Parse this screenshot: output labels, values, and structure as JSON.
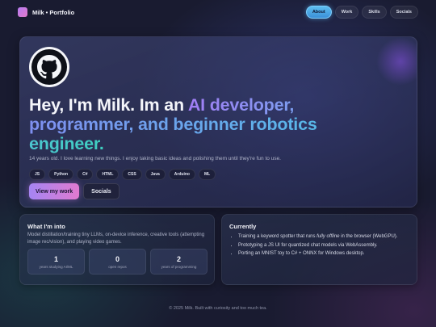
{
  "nav": {
    "brand": "Milk • Portfolio",
    "links": [
      {
        "label": "About",
        "active": true
      },
      {
        "label": "Work",
        "active": false
      },
      {
        "label": "Skills",
        "active": false
      },
      {
        "label": "Socials",
        "active": false
      }
    ]
  },
  "hero": {
    "avatar_icon": "github-octocat-icon",
    "headline": {
      "plain": "Hey, I'm Milk. Im an ",
      "highlight_1": "AI developer,",
      "highlight_2": "programmer, and beginner robotics",
      "highlight_3": "engineer."
    },
    "bio": "14 years old. I love learning new things. I enjoy taking basic ideas and polishing them until they're fun to use.",
    "tags": [
      "JS",
      "Python",
      "C#",
      "HTML",
      "CSS",
      "Java",
      "Arduino",
      "ML"
    ],
    "primary_button": "View my work",
    "secondary_button": "Socials"
  },
  "interests": {
    "title": "What I'm into",
    "description": "Model distillation/training tiny LLMs, on-device inference, creative tools (attempting image rec/vision), and playing video games.",
    "stats": [
      {
        "value": "1",
        "label": "years studying AI/ML"
      },
      {
        "value": "0",
        "label": "open repos"
      },
      {
        "value": "2",
        "label": "years of programming"
      }
    ]
  },
  "currently": {
    "title": "Currently",
    "items": [
      {
        "before": "Training a keyword spotter that runs ",
        "emphasis": "fully offline",
        "after": " in the browser (WebGPU)."
      },
      {
        "before": "Prototyping a JS UI for quantized chat models via WebAssembly.",
        "emphasis": "",
        "after": ""
      },
      {
        "before": "Porting an MNIST toy to C# + ONNX for Windows desktop.",
        "emphasis": "",
        "after": ""
      }
    ]
  },
  "footer": "© 2025 Milk. Built with curiosity and too much tea.",
  "colors": {
    "accent_blue": "#4aa8ee",
    "accent_purple": "#a585f3",
    "accent_pink": "#e07ad0",
    "accent_teal": "#3ed0c0",
    "background": "#191b30"
  }
}
